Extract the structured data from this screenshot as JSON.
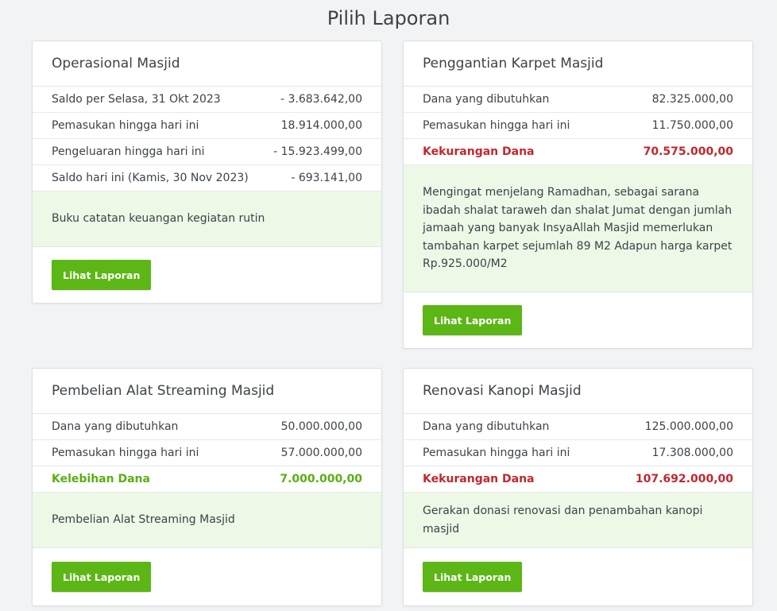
{
  "page_title": "Pilih Laporan",
  "colors": {
    "button": "#5cb615",
    "deficit": "#c2272d",
    "surplus": "#5aae12",
    "description_bg": "#eef8e6"
  },
  "cards": [
    {
      "title": "Operasional Masjid",
      "rows": [
        {
          "label": "Saldo per Selasa, 31 Okt 2023",
          "value": "- 3.683.642,00"
        },
        {
          "label": "Pemasukan hingga hari ini",
          "value": "18.914.000,00"
        },
        {
          "label": "Pengeluaran hingga hari ini",
          "value": "- 15.923.499,00"
        },
        {
          "label": "Saldo hari ini (Kamis, 30 Nov 2023)",
          "value": "- 693.141,00"
        }
      ],
      "description": "Buku catatan keuangan kegiatan rutin",
      "button_label": "Lihat Laporan"
    },
    {
      "title": "Penggantian Karpet Masjid",
      "rows": [
        {
          "label": "Dana yang dibutuhkan",
          "value": "82.325.000,00"
        },
        {
          "label": "Pemasukan hingga hari ini",
          "value": "11.750.000,00"
        },
        {
          "label": "Kekurangan Dana",
          "value": "70.575.000,00",
          "status": "deficit"
        }
      ],
      "description": "Mengingat menjelang Ramadhan, sebagai sarana ibadah shalat taraweh dan shalat Jumat dengan jumlah jamaah yang banyak InsyaAllah Masjid memerlukan tambahan karpet sejumlah 89 M2 Adapun harga karpet Rp.925.000/M2",
      "button_label": "Lihat Laporan"
    },
    {
      "title": "Pembelian Alat Streaming Masjid",
      "rows": [
        {
          "label": "Dana yang dibutuhkan",
          "value": "50.000.000,00"
        },
        {
          "label": "Pemasukan hingga hari ini",
          "value": "57.000.000,00"
        },
        {
          "label": "Kelebihan Dana",
          "value": "7.000.000,00",
          "status": "surplus"
        }
      ],
      "description": "Pembelian Alat Streaming Masjid",
      "button_label": "Lihat Laporan"
    },
    {
      "title": "Renovasi Kanopi Masjid",
      "rows": [
        {
          "label": "Dana yang dibutuhkan",
          "value": "125.000.000,00"
        },
        {
          "label": "Pemasukan hingga hari ini",
          "value": "17.308.000,00"
        },
        {
          "label": "Kekurangan Dana",
          "value": "107.692.000,00",
          "status": "deficit"
        }
      ],
      "description": "Gerakan donasi renovasi dan penambahan kanopi masjid",
      "button_label": "Lihat Laporan"
    }
  ]
}
